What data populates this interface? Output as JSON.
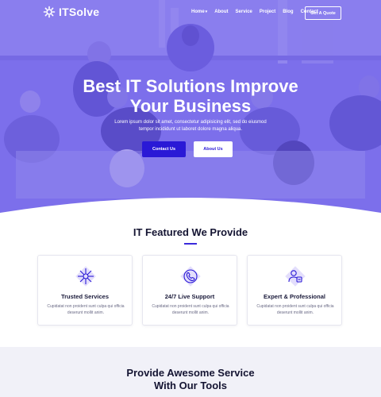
{
  "brand": {
    "name": "ITSolve",
    "accent": "#2a19d6",
    "hero_tint": "#7a6ce8"
  },
  "nav": {
    "items": [
      {
        "label": "Home",
        "has_caret": true
      },
      {
        "label": "About"
      },
      {
        "label": "Service"
      },
      {
        "label": "Project"
      },
      {
        "label": "Blog"
      },
      {
        "label": "Contact"
      }
    ],
    "quote_button": "Get A Quote"
  },
  "hero": {
    "title_line1": "Best IT Solutions Improve",
    "title_line2": "Your Business",
    "subtitle_line1": "Lorem ipsum dolor sit amet, consectetur adipisicing elit, sed do eiusmod",
    "subtitle_line2": "tempor incididunt ut laboret dolore magna aliqua.",
    "contact_button": "Contact Us",
    "about_button": "About Us"
  },
  "featured": {
    "title": "IT Featured We Provide",
    "cards": [
      {
        "icon": "network-icon",
        "title": "Trusted Services",
        "text_line1": "Cupidatat non proident sunt culpa qui officia",
        "text_line2": "deserunt mollit anim."
      },
      {
        "icon": "support-phone-icon",
        "title": "24/7 Live Support",
        "text_line1": "Cupidatat non proident sunt culpa qui officia",
        "text_line2": "deserunt mollit anim."
      },
      {
        "icon": "expert-user-icon",
        "title": "Expert & Professional",
        "text_line1": "Cupidatat non proident sunt culpa qui officia",
        "text_line2": "deserunt mollit anim."
      }
    ]
  },
  "services": {
    "title_line1": "Provide Awesome Service",
    "title_line2": "With Our Tools"
  }
}
